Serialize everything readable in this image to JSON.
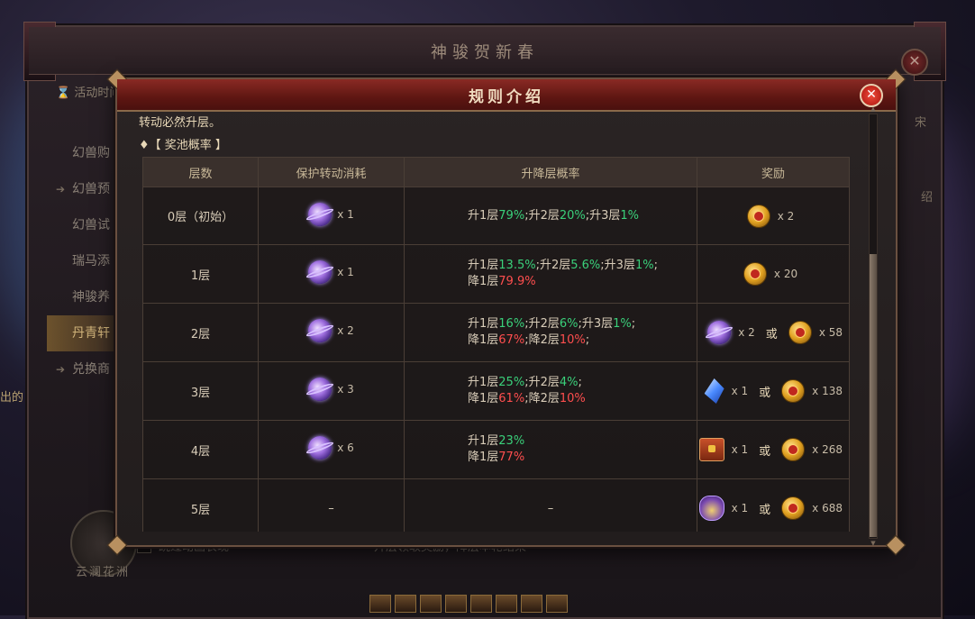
{
  "outer": {
    "title": "神骏贺新春",
    "activity_time": "活动时间",
    "sidebar": [
      {
        "label": "幻兽购",
        "arrow": ""
      },
      {
        "label": "幻兽预",
        "arrow": "➔"
      },
      {
        "label": "幻兽试",
        "arrow": ""
      },
      {
        "label": "瑞马添",
        "arrow": ""
      },
      {
        "label": "神骏养",
        "arrow": ""
      },
      {
        "label": "丹青轩",
        "arrow": ""
      },
      {
        "label": "兑换商",
        "arrow": "➔"
      }
    ],
    "skip_animation": "跳过动画表现",
    "bottom_hint": "升层领取奖励，降层本轮结束",
    "logo_text": "云澜花洲",
    "right_peek_1": "绍",
    "right_peek_2": "宋",
    "left_peek": "出的"
  },
  "modal": {
    "title": "规则介绍",
    "intro_text": "转动必然升层。",
    "section_label": "♦【 奖池概率 】",
    "columns": [
      "层数",
      "保护转动消耗",
      "升降层概率",
      "奖励"
    ],
    "rows": [
      {
        "layer": "0层（初始）",
        "cost": {
          "icon": "orb-icon",
          "qty": "x 1"
        },
        "prob_lines": [
          [
            [
              "升1层",
              ""
            ],
            [
              "79%",
              "up"
            ],
            [
              ";升2层",
              ""
            ],
            [
              "20%",
              "up"
            ],
            [
              ";升3层",
              ""
            ],
            [
              "1%",
              "up"
            ]
          ]
        ],
        "rewards": [
          {
            "icon": "coin-icon",
            "qty": "x 2"
          }
        ]
      },
      {
        "layer": "1层",
        "cost": {
          "icon": "orb-icon",
          "qty": "x 1"
        },
        "prob_lines": [
          [
            [
              "升1层",
              ""
            ],
            [
              "13.5%",
              "up"
            ],
            [
              ";升2层",
              ""
            ],
            [
              "5.6%",
              "up"
            ],
            [
              ";升3层",
              ""
            ],
            [
              "1%",
              "up"
            ],
            [
              ";",
              ""
            ]
          ],
          [
            [
              "降1层",
              ""
            ],
            [
              "79.9%",
              "down"
            ]
          ]
        ],
        "rewards": [
          {
            "icon": "coin-icon",
            "qty": "x 20"
          }
        ]
      },
      {
        "layer": "2层",
        "cost": {
          "icon": "orb-icon",
          "qty": "x 2"
        },
        "prob_lines": [
          [
            [
              "升1层",
              ""
            ],
            [
              "16%",
              "up"
            ],
            [
              ";升2层",
              ""
            ],
            [
              "6%",
              "up"
            ],
            [
              ";升3层",
              ""
            ],
            [
              "1%",
              "up"
            ],
            [
              ";",
              ""
            ]
          ],
          [
            [
              "降1层",
              ""
            ],
            [
              "67%",
              "down"
            ],
            [
              ";降2层",
              ""
            ],
            [
              "10%",
              "down"
            ],
            [
              ";",
              ""
            ]
          ]
        ],
        "rewards": [
          {
            "icon": "orb-icon",
            "qty": "x 2"
          },
          {
            "icon": "coin-icon",
            "qty": "x 58"
          }
        ]
      },
      {
        "layer": "3层",
        "cost": {
          "icon": "orb-icon",
          "qty": "x 3"
        },
        "prob_lines": [
          [
            [
              "升1层",
              ""
            ],
            [
              "25%",
              "up"
            ],
            [
              ";升2层",
              ""
            ],
            [
              "4%",
              "up"
            ],
            [
              ";",
              ""
            ]
          ],
          [
            [
              "降1层",
              ""
            ],
            [
              "61%",
              "down"
            ],
            [
              ";降2层",
              ""
            ],
            [
              "10%",
              "down"
            ]
          ]
        ],
        "rewards": [
          {
            "icon": "crystal-icon",
            "qty": "x 1"
          },
          {
            "icon": "coin-icon",
            "qty": "x 138"
          }
        ]
      },
      {
        "layer": "4层",
        "cost": {
          "icon": "orb-icon",
          "qty": "x 6"
        },
        "prob_lines": [
          [
            [
              "升1层",
              ""
            ],
            [
              "23%",
              "up"
            ]
          ],
          [
            [
              "降1层",
              ""
            ],
            [
              "77%",
              "down"
            ]
          ]
        ],
        "rewards": [
          {
            "icon": "chest-icon",
            "qty": "x 1"
          },
          {
            "icon": "coin-icon",
            "qty": "x 268"
          }
        ]
      },
      {
        "layer": "5层",
        "cost": null,
        "cost_text": "–",
        "prob_text": "–",
        "prob_lines": [],
        "rewards": [
          {
            "icon": "bag-icon",
            "qty": "x 1"
          },
          {
            "icon": "coin-icon",
            "qty": "x 688"
          }
        ]
      }
    ],
    "or_text": "或"
  },
  "colors": {
    "up": "#3ad07a",
    "down": "#ff4e4e",
    "title_bar": "#5e1612",
    "accent_gold": "#b89060"
  }
}
